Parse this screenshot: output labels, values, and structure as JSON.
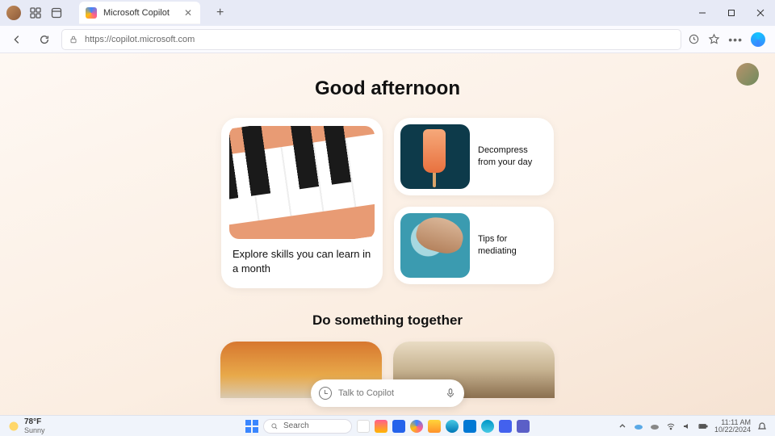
{
  "window": {
    "tab_title": "Microsoft Copilot",
    "url": "https://copilot.microsoft.com"
  },
  "page": {
    "greeting": "Good afternoon",
    "card_large": "Explore skills you can learn in a month",
    "card_decompress": "Decompress from your day",
    "card_mediate": "Tips for mediating",
    "section2": "Do something together",
    "chat_placeholder": "Talk to Copilot"
  },
  "taskbar": {
    "temp": "78°F",
    "weather": "Sunny",
    "search": "Search",
    "time": "11:11 AM",
    "date": "10/22/2024"
  }
}
